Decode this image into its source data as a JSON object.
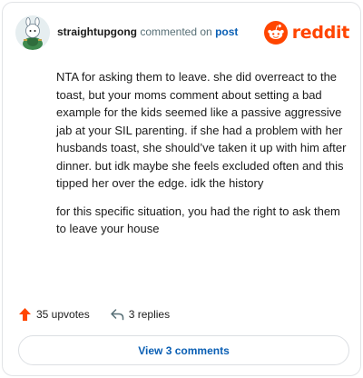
{
  "comment": {
    "username": "straightupgong",
    "commented_text": "commented on",
    "post_link": "post",
    "body": [
      "NTA for asking them to leave. she did overreact to the toast, but your moms comment about setting a bad example for the kids seemed like a passive aggressive jab at your SIL parenting. if she had a problem with her husbands toast, she should’ve taken it up with him after dinner. but idk maybe she feels excluded often and this tipped her over the edge. idk the history",
      "for this specific situation, you had the right to ask them to leave your house"
    ]
  },
  "brand": {
    "name": "reddit",
    "icon": "reddit-snoo-icon",
    "color": "#ff4500"
  },
  "actions": {
    "upvotes": "35 upvotes",
    "replies": "3 replies"
  },
  "view_comments": "View 3 comments"
}
